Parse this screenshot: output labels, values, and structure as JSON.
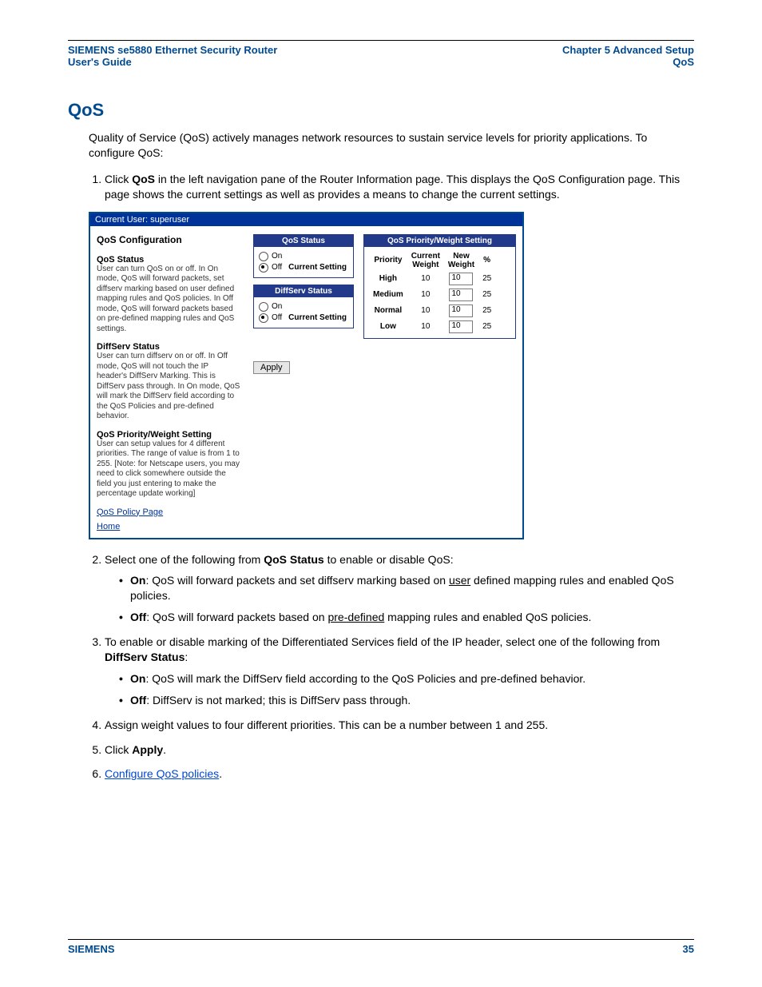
{
  "header": {
    "left1": "SIEMENS se5880 Ethernet Security Router",
    "left2": "User's Guide",
    "right1": "Chapter 5  Advanced Setup",
    "right2": "QoS"
  },
  "h1": "QoS",
  "intro": "Quality of Service (QoS) actively manages network resources to sustain service levels for priority applications. To configure QoS:",
  "steps": {
    "s1a": "Click ",
    "s1b": "QoS",
    "s1c": " in the left navigation pane of the Router Information page. This displays the QoS Configuration page. This page shows the current settings as well as provides a means to change the current settings.",
    "s2a": "Select one of the following from ",
    "s2b": "QoS Status",
    "s2c": " to enable or disable QoS:",
    "s2_on_b": "On",
    "s2_on_t1": ": QoS will forward packets and set diffserv marking based on ",
    "s2_on_u": "user",
    "s2_on_t2": " defined mapping rules and enabled QoS policies.",
    "s2_off_b": "Off",
    "s2_off_t1": ": QoS will forward packets based on ",
    "s2_off_u": "pre-defined",
    "s2_off_t2": " mapping rules and enabled QoS policies.",
    "s3a": "To enable or disable marking of the Differentiated Services field of the IP header, select one of the following from ",
    "s3b": "DiffServ Status",
    "s3c": ":",
    "s3_on_b": "On",
    "s3_on_t": ": QoS will mark the DiffServ field according to the QoS Policies and pre-defined behavior.",
    "s3_off_b": "Off",
    "s3_off_t": ": DiffServ is not marked; this is DiffServ pass through.",
    "s4": "Assign weight values to four different priorities. This can be a number between 1 and 255.",
    "s5a": "Click ",
    "s5b": "Apply",
    "s5c": ".",
    "s6": "Configure QoS policies"
  },
  "figure": {
    "bar": "Current User: superuser",
    "title": "QoS Configuration",
    "qos_status_h": "QoS Status",
    "qos_status_p": "User can turn QoS on or off. In On mode, QoS will forward packets, set diffserv marking based on user defined mapping rules and QoS policies. In Off mode, QoS will forward packets based on pre-defined mapping rules and QoS settings.",
    "diff_h": "DiffServ Status",
    "diff_p": "User can turn diffserv on or off. In Off mode, QoS will not touch the IP header's DiffServ Marking. This is DiffServ pass through. In On mode, QoS will mark the DiffServ field according to the QoS Policies and pre-defined behavior.",
    "pw_h": "QoS Priority/Weight Setting",
    "pw_p": "User can setup values for 4 different priorities. The range of value is from 1 to 255. [Note: for Netscape users, you may need to click somewhere outside the field you just entering to make the percentage update working]",
    "link1": "QoS Policy Page",
    "link2": "Home",
    "panel_qos": "QoS Status",
    "panel_diff": "DiffServ Status",
    "panel_pw": "QoS Priority/Weight Setting",
    "on": "On",
    "off": "Off",
    "current": "Current Setting",
    "th_priority": "Priority",
    "th_cur": "Current Weight",
    "th_new": "New Weight",
    "th_pct": "%",
    "rows": [
      {
        "p": "High",
        "cur": "10",
        "new": "10",
        "pct": "25"
      },
      {
        "p": "Medium",
        "cur": "10",
        "new": "10",
        "pct": "25"
      },
      {
        "p": "Normal",
        "cur": "10",
        "new": "10",
        "pct": "25"
      },
      {
        "p": "Low",
        "cur": "10",
        "new": "10",
        "pct": "25"
      }
    ],
    "apply": "Apply"
  },
  "footer": {
    "left": "SIEMENS",
    "right": "35"
  }
}
